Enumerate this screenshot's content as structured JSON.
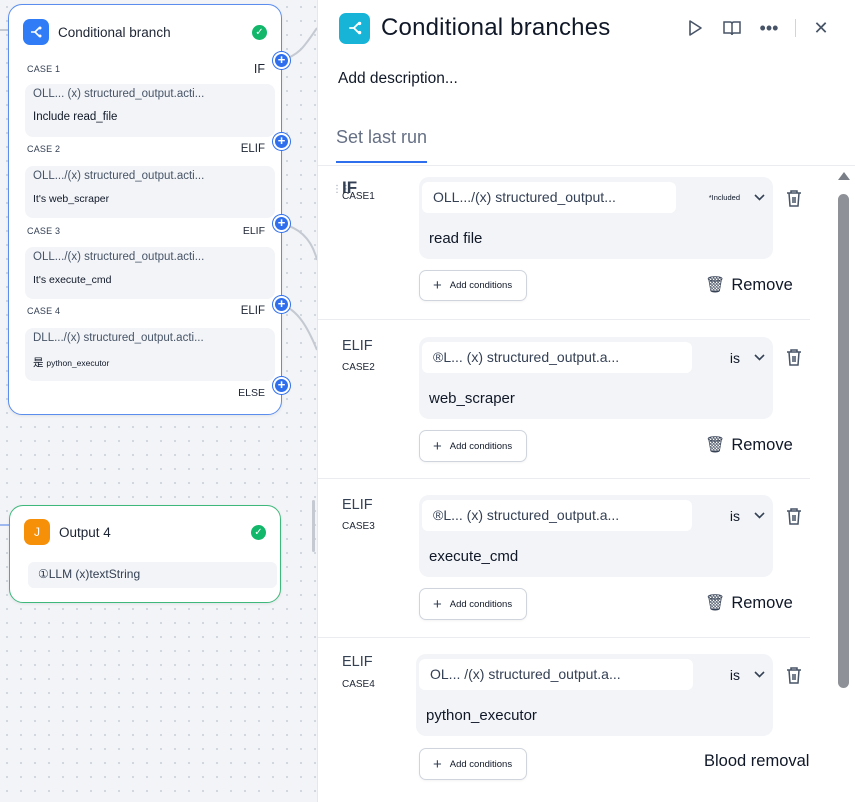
{
  "canvas": {
    "branch_node": {
      "title": "Conditional branch",
      "cases": [
        {
          "label": "CASE 1",
          "keyword": "IF",
          "var": "OLL... (x) structured_output.acti...",
          "value": "Include read_file"
        },
        {
          "label": "CASE 2",
          "keyword": "ELIF",
          "var": "OLL.../(x) structured_output.acti...",
          "value": "It's web_scraper"
        },
        {
          "label": "CASE 3",
          "keyword": "ELIF",
          "var": "OLL.../(x) structured_output.acti...",
          "value": "It's execute_cmd"
        },
        {
          "label": "CASE 4",
          "keyword": "ELIF",
          "var": "DLL.../(x) structured_output.acti...",
          "value_prefix": "是",
          "value": "python_executor"
        }
      ],
      "else_label": "ELSE"
    },
    "output_node": {
      "title": "Output 4",
      "variable": "①LLM (x)textString"
    }
  },
  "panel": {
    "title": "Conditional branches",
    "description_placeholder": "Add description...",
    "tab_label": "Set last run",
    "cases": [
      {
        "keyword": "IF",
        "case_label": "CASE1",
        "var": "OLL.../(x) structured_output...",
        "operator": "*Included",
        "value": "read file",
        "add_label": "Add conditions",
        "remove_label": "Remove"
      },
      {
        "keyword": "ELIF",
        "case_label": "CASE2",
        "var": "®L... (x) structured_output.a...",
        "operator": "is",
        "value": "web_scraper",
        "add_label": "Add conditions",
        "remove_label": "Remove"
      },
      {
        "keyword": "ELIF",
        "case_label": "CASE3",
        "var": "®L... (x) structured_output.a...",
        "operator": "is",
        "value": "execute_cmd",
        "add_label": "Add conditions",
        "remove_label": "Remove"
      },
      {
        "keyword": "ELIF",
        "case_label": "CASE4",
        "var": "OL... /(x) structured_output.a...",
        "operator": "is",
        "value": "python_executor",
        "add_label": "Add conditions",
        "remove_label": "Blood removal"
      }
    ]
  },
  "icons": {
    "branch": "branch-icon",
    "output": "output-icon",
    "success": "check-circle-icon",
    "run": "play-icon",
    "docs": "book-icon",
    "more": "ellipsis-icon",
    "close": "close-icon",
    "delete": "trash-icon",
    "add": "plus-icon"
  },
  "colors": {
    "accent": "#2f6fed",
    "branch_node_border": "#5b8def",
    "output_node_border": "#3fb97b",
    "panel_icon": "#17b4d8",
    "success": "#12b76a"
  }
}
